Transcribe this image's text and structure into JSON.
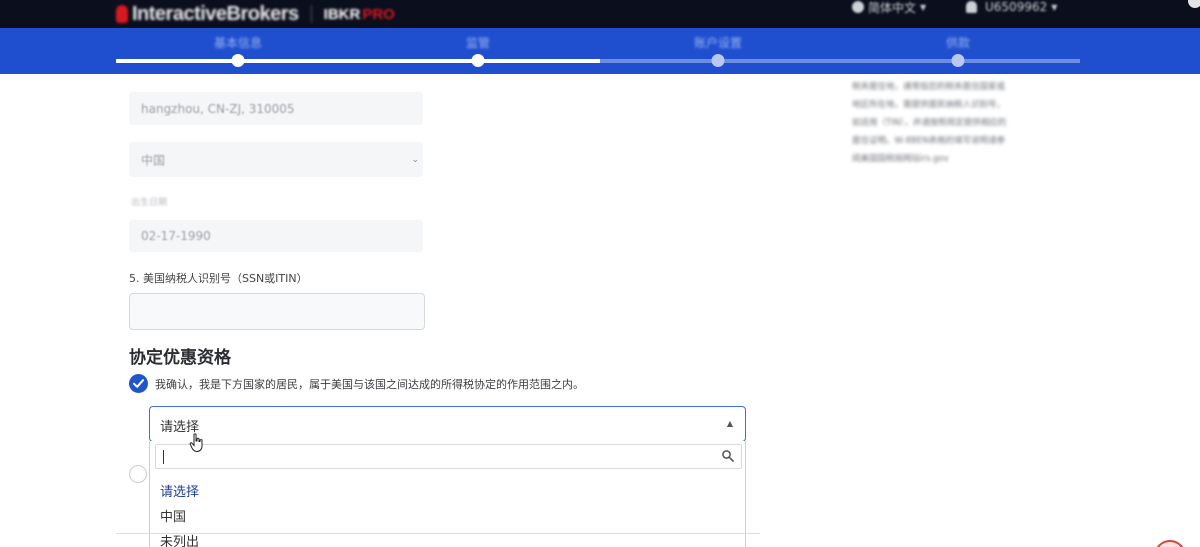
{
  "header": {
    "brand": "InteractiveBrokers",
    "product_prefix": "IBKR",
    "product_suffix": "PRO",
    "language": "简体中文",
    "user_id": "U6509962"
  },
  "steps": {
    "items": [
      {
        "label": "基本信息"
      },
      {
        "label": "监管"
      },
      {
        "label": "账户设置"
      },
      {
        "label": "供款"
      }
    ],
    "current_index": 1,
    "progress": 0.5
  },
  "form": {
    "address_line": "hangzhou, CN-ZJ, 310005",
    "country_value": "中国",
    "dob_label": "出生日期",
    "dob_value": "02-17-1990",
    "ssn_question": "5. 美国纳税人识别号（SSN或ITIN）",
    "ssn_value": "",
    "treaty_title": "协定优惠资格",
    "treaty_confirm_text": "我确认，我是下方国家的居民，属于美国与该国之间达成的所得税协定的作用范围之内。",
    "treaty_confirm_checked": true
  },
  "dropdown": {
    "selected": "请选择",
    "search_value": "",
    "options": [
      "请选择",
      "中国",
      "未列出"
    ],
    "highlighted_index": 0
  },
  "info_panel": {
    "lines": [
      "税务居住地，通常指您的税务居住国家或",
      "地区所在地，需提供居民纳税人识别号，",
      "如适用（TIN），并请按照规定提供相应的",
      "居住证明。W-8BEN表格的填写说明请参",
      "阅美国国税局网站irs.gov"
    ]
  },
  "colors": {
    "header_bg": "#0b0e1c",
    "step_bar_bg": "#1f4fcf",
    "accent": "#1f57c9",
    "brand_red": "#d71920"
  }
}
